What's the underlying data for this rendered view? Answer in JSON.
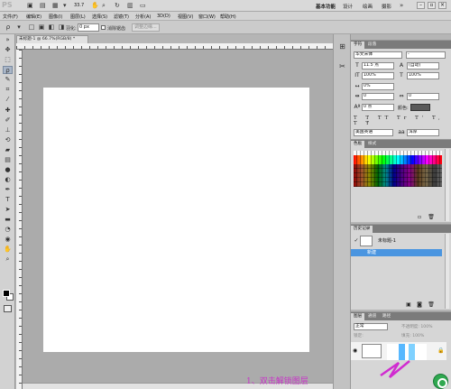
{
  "app": {
    "logo": "PS",
    "zoom": "33.7",
    "workspaces": [
      {
        "label": "基本功能",
        "active": true
      },
      {
        "label": "设计",
        "active": false
      },
      {
        "label": "绘画",
        "active": false
      },
      {
        "label": "摄影",
        "active": false
      }
    ],
    "window_controls": [
      "minimize",
      "restore",
      "close"
    ]
  },
  "menu": [
    "文件(F)",
    "编辑(E)",
    "图像(I)",
    "图层(L)",
    "选择(S)",
    "滤镜(T)",
    "分析(A)",
    "3D(D)",
    "视图(V)",
    "窗口(W)",
    "帮助(H)"
  ],
  "options": {
    "feather_label": "羽化:",
    "feather_value": "0 px",
    "antialias_label": "消除锯齿",
    "antialias_checked": true,
    "refine_button": "调整边缘..."
  },
  "document": {
    "tab_title": "未标题-1 @ 66.7%(RGB/8) *"
  },
  "character_panel": {
    "tabs": [
      "字符",
      "段落"
    ],
    "font_family": "华文宋体",
    "font_style": "-",
    "font_size": "11.5 点",
    "leading": "(自动)",
    "vertical_scale": "100%",
    "horizontal_scale": "100%",
    "kerning": "0%",
    "tracking": "0",
    "baseline": "0 点",
    "color_label": "颜色:",
    "style_buttons": "T T TT Tr T' T, T Ŧ",
    "language": "美国英语",
    "antialias": "浑厚"
  },
  "swatches_panel": {
    "tabs": [
      "色板",
      "样式"
    ]
  },
  "history_panel": {
    "tabs": [
      "历史记录"
    ],
    "snapshot": "未标题-1",
    "state": "新建"
  },
  "layers_panel": {
    "tabs": [
      "图层",
      "通道",
      "路径"
    ],
    "blend_mode": "正常",
    "opacity": "不透明度: 100%",
    "lock": "锁定:",
    "fill": "填充: 100%"
  },
  "annotation": "1、双击解锁图层"
}
